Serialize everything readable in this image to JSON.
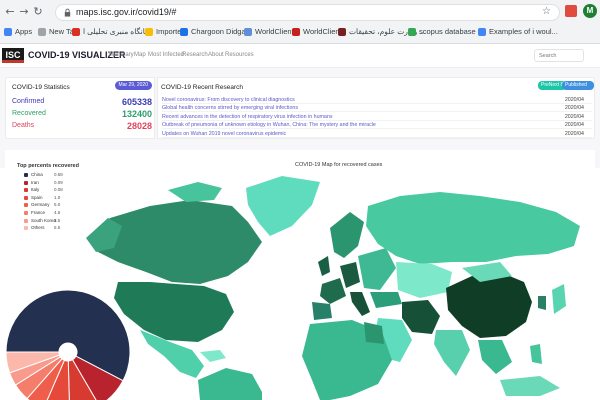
{
  "browser": {
    "url": "maps.isc.gov.ir/covid19/#",
    "bookmarks": [
      "Apps",
      "New Tab",
      "بانگاه منبری تحلیلی ا...",
      "Imported",
      "Chargoon Didgah",
      "WorldClient",
      "WorldClient",
      "وزارت علوم، تحقیقات ...",
      "scopus database -...",
      "Examples of i woul..."
    ],
    "profile_initial": "M"
  },
  "site": {
    "logo": "ISC",
    "title": "COVID-19 VISUALIZER",
    "nav": [
      "Summary",
      "Map",
      "Most Infected",
      "Research",
      "About",
      "Resources"
    ],
    "search_placeholder": "Search"
  },
  "stats": {
    "title": "COVID-19 Statistics",
    "date": "Mar 29, 2020",
    "confirmed_label": "Confirmed",
    "confirmed_value": "605338",
    "recovered_label": "Recovered",
    "recovered_value": "132400",
    "deaths_label": "Deaths",
    "deaths_value": "28028",
    "confirmed_color": "#3b3bb5",
    "recovered_color": "#2e9e6a",
    "deaths_color": "#e0435c"
  },
  "research": {
    "title": "COVID-19 Recent Research",
    "badge_left": "PreNext 8",
    "badge_right": "Published 290",
    "items": [
      {
        "title": "Novel coronavirus: From discovery to clinical diagnostics",
        "date": "2020/04"
      },
      {
        "title": "Global health concerns stirred by emerging viral infections",
        "date": "2020/04"
      },
      {
        "title": "Recent advances in the detection of respiratory virus infection in humans",
        "date": "2020/04"
      },
      {
        "title": "Outbreak of pneumonia of unknown etiology in Wuhan, China: The mystery and the miracle",
        "date": "2020/04"
      },
      {
        "title": "Updates on Wuhan 2019 novel coronavirus epidemic",
        "date": "2020/04"
      }
    ]
  },
  "legend": {
    "title": "Top percents recovered",
    "items": [
      {
        "name": "China",
        "value": "0.58",
        "color": "#24304f"
      },
      {
        "name": "Iran",
        "value": "0.09",
        "color": "#b8232d"
      },
      {
        "name": "Italy",
        "value": "0.08",
        "color": "#d63a30"
      },
      {
        "name": "Spain",
        "value": "1.0",
        "color": "#e4493a"
      },
      {
        "name": "Germany",
        "value": "5.0",
        "color": "#ef5e4b"
      },
      {
        "name": "France",
        "value": "4.6",
        "color": "#f47d6c"
      },
      {
        "name": "South Korea",
        "value": "3.5",
        "color": "#f89a8c"
      },
      {
        "name": "Others",
        "value": "5.5",
        "color": "#fbb8ab"
      }
    ]
  },
  "map": {
    "title": "COVID-19 Map for recovered cases"
  },
  "chart_data": {
    "type": "pie",
    "title": "Top percents recovered",
    "categories": [
      "China",
      "Iran",
      "Italy",
      "Spain",
      "Germany",
      "France",
      "South Korea",
      "Others"
    ],
    "values": [
      58,
      9,
      8,
      7,
      5,
      4.6,
      3.5,
      5.5
    ],
    "colors": [
      "#24304f",
      "#b8232d",
      "#d63a30",
      "#e4493a",
      "#ef5e4b",
      "#f47d6c",
      "#f89a8c",
      "#fbb8ab"
    ]
  }
}
